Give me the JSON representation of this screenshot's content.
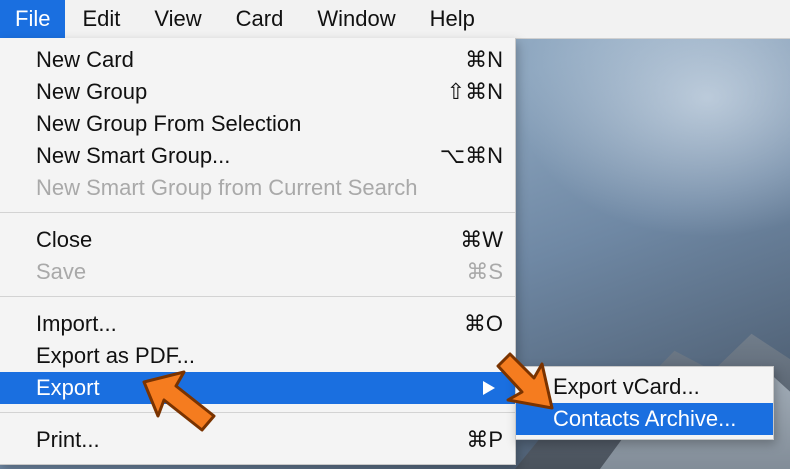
{
  "menubar": {
    "items": [
      {
        "label": "File"
      },
      {
        "label": "Edit"
      },
      {
        "label": "View"
      },
      {
        "label": "Card"
      },
      {
        "label": "Window"
      },
      {
        "label": "Help"
      }
    ]
  },
  "file_menu": {
    "new_card": {
      "label": "New Card",
      "shortcut": "⌘N"
    },
    "new_group": {
      "label": "New Group",
      "shortcut": "⇧⌘N"
    },
    "new_group_from_selection": {
      "label": "New Group From Selection"
    },
    "new_smart_group": {
      "label": "New Smart Group...",
      "shortcut": "⌥⌘N"
    },
    "new_smart_group_from_search": {
      "label": "New Smart Group from Current Search"
    },
    "close": {
      "label": "Close",
      "shortcut": "⌘W"
    },
    "save": {
      "label": "Save",
      "shortcut": "⌘S"
    },
    "import": {
      "label": "Import...",
      "shortcut": "⌘O"
    },
    "export_pdf": {
      "label": "Export as PDF..."
    },
    "export": {
      "label": "Export"
    },
    "print": {
      "label": "Print...",
      "shortcut": "⌘P"
    }
  },
  "export_submenu": {
    "export_vcard": {
      "label": "Export vCard..."
    },
    "contacts_archive": {
      "label": "Contacts Archive..."
    }
  },
  "colors": {
    "highlight": "#1a6fe0",
    "annotation_arrow": "#f57c1f"
  }
}
